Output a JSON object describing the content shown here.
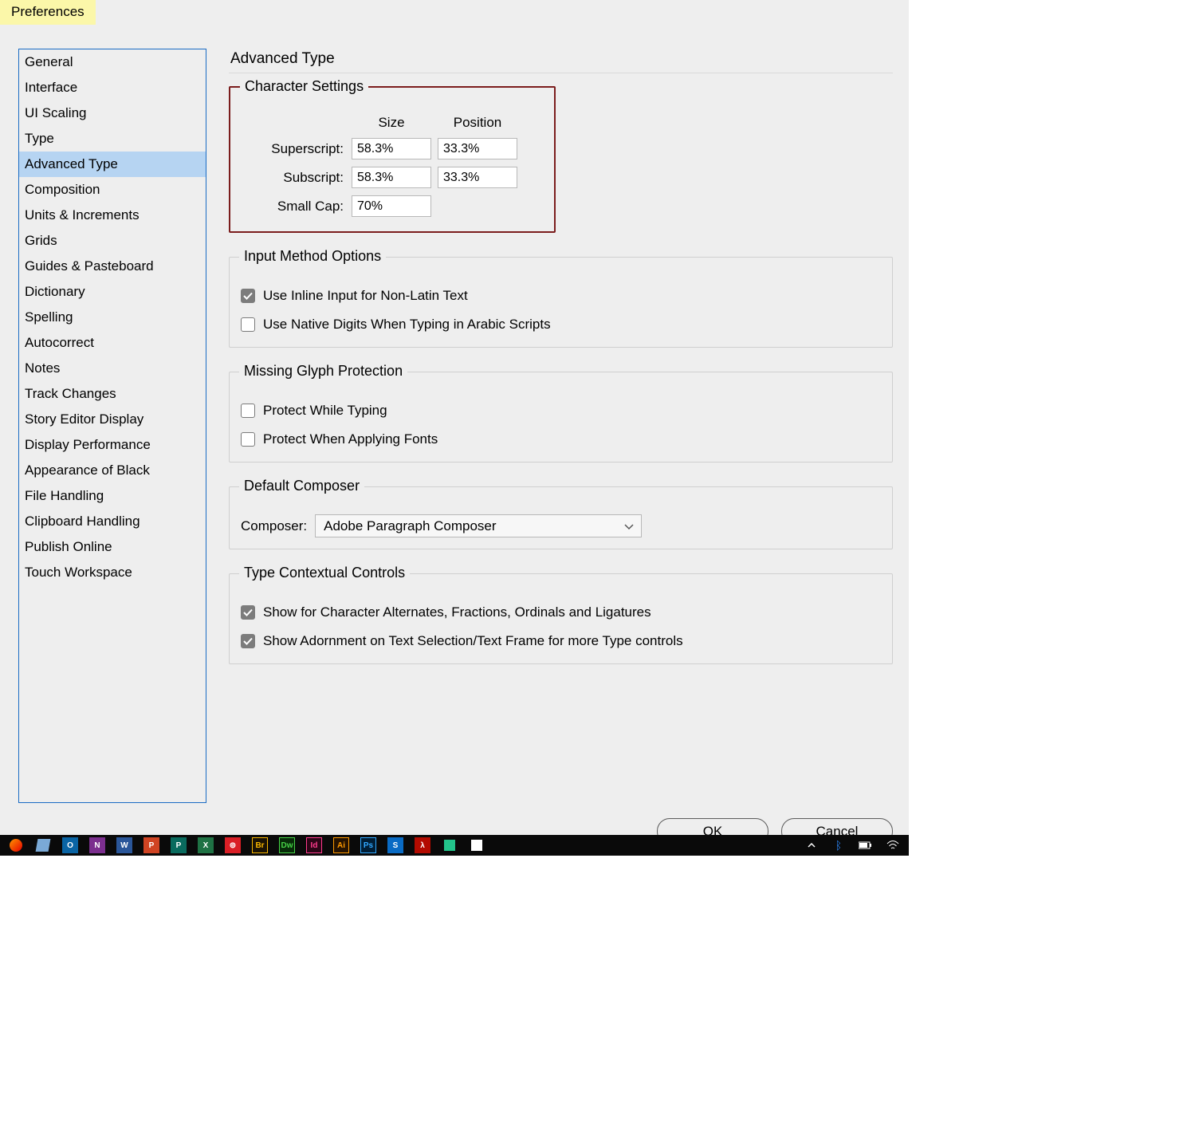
{
  "window": {
    "title": "Preferences"
  },
  "sidebar": {
    "items": [
      "General",
      "Interface",
      "UI Scaling",
      "Type",
      "Advanced Type",
      "Composition",
      "Units & Increments",
      "Grids",
      "Guides & Pasteboard",
      "Dictionary",
      "Spelling",
      "Autocorrect",
      "Notes",
      "Track Changes",
      "Story Editor Display",
      "Display Performance",
      "Appearance of Black",
      "File Handling",
      "Clipboard Handling",
      "Publish Online",
      "Touch Workspace"
    ],
    "selected_index": 4
  },
  "main": {
    "title": "Advanced Type",
    "character_settings": {
      "legend": "Character Settings",
      "headers": {
        "size": "Size",
        "position": "Position"
      },
      "rows": {
        "superscript": {
          "label": "Superscript:",
          "size": "58.3%",
          "position": "33.3%"
        },
        "subscript": {
          "label": "Subscript:",
          "size": "58.3%",
          "position": "33.3%"
        },
        "smallcap": {
          "label": "Small Cap:",
          "size": "70%"
        }
      }
    },
    "input_method": {
      "legend": "Input Method Options",
      "opt1": {
        "label": "Use Inline Input for Non-Latin Text",
        "checked": true
      },
      "opt2": {
        "label": "Use Native Digits When Typing in Arabic Scripts",
        "checked": false
      }
    },
    "glyph": {
      "legend": "Missing Glyph Protection",
      "opt1": {
        "label": "Protect While Typing",
        "checked": false
      },
      "opt2": {
        "label": "Protect When Applying Fonts",
        "checked": false
      }
    },
    "composer": {
      "legend": "Default Composer",
      "label": "Composer:",
      "value": "Adobe Paragraph Composer"
    },
    "contextual": {
      "legend": "Type Contextual Controls",
      "opt1": {
        "label": "Show for Character Alternates, Fractions, Ordinals and Ligatures",
        "checked": true
      },
      "opt2": {
        "label": "Show Adornment on Text Selection/Text Frame for more Type controls",
        "checked": true
      }
    }
  },
  "buttons": {
    "ok": "OK",
    "cancel": "Cancel"
  }
}
